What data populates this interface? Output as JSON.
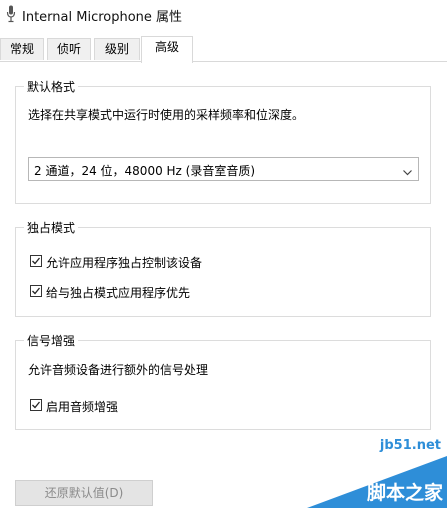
{
  "window": {
    "title": "Internal Microphone 属性"
  },
  "tabs": [
    {
      "label": "常规"
    },
    {
      "label": "侦听"
    },
    {
      "label": "级别"
    },
    {
      "label": "高级",
      "active": true
    }
  ],
  "default_format": {
    "title": "默认格式",
    "description": "选择在共享模式中运行时使用的采样频率和位深度。",
    "selected": "2 通道，24 位，48000 Hz (录音室音质)"
  },
  "exclusive_mode": {
    "title": "独占模式",
    "options": [
      {
        "label": "允许应用程序独占控制该设备",
        "checked": true
      },
      {
        "label": "给与独占模式应用程序优先",
        "checked": true
      }
    ]
  },
  "signal_enhancement": {
    "title": "信号增强",
    "description": "允许音频设备进行额外的信号处理",
    "options": [
      {
        "label": "启用音频增强",
        "checked": true
      }
    ]
  },
  "buttons": {
    "restore_default": "还原默认值(D)"
  },
  "watermark": {
    "site": "jb51.net",
    "name": "脚本之家"
  },
  "colors": {
    "accent": "#2e8ed8",
    "border": "#dcdcdc"
  }
}
